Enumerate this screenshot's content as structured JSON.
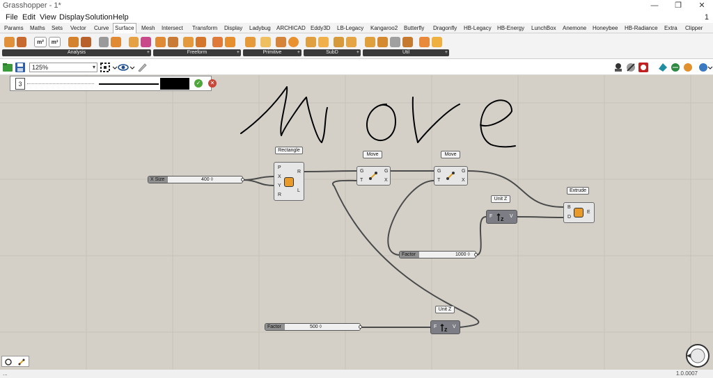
{
  "window": {
    "title": "Grasshopper - 1*",
    "minimize": "—",
    "restore": "❐",
    "close": "✕"
  },
  "menu": {
    "items": [
      "File",
      "Edit",
      "View",
      "Display",
      "Solution",
      "Help"
    ],
    "counter": "1"
  },
  "tabs": [
    "Params",
    "Maths",
    "Sets",
    "Vector",
    "Curve",
    "Surface",
    "Mesh",
    "Intersect",
    "Transform",
    "Display",
    "Ladybug",
    "ARCHICAD",
    "Eddy3D",
    "LB-Legacy",
    "Kangaroo2",
    "Butterfly",
    "Dragonfly",
    "HB-Legacy",
    "HB-Energy",
    "LunchBox",
    "Anemone",
    "Honeybee",
    "HB-Radiance",
    "Extra",
    "Clipper"
  ],
  "active_tab": "Surface",
  "ribbon_groups": [
    "Analysis",
    "Freeform",
    "Primitive",
    "SubD",
    "Util"
  ],
  "ribbon_plus": "+",
  "toolbar": {
    "zoom": "125%",
    "zoom_arrow": "▾"
  },
  "slider_panel": {
    "value": "3",
    "ok": "✓",
    "cancel": "✕"
  },
  "sketch_text": "Move",
  "components": {
    "rectangle": {
      "label": "Rectangle",
      "inputs": [
        "P",
        "X",
        "Y",
        "R"
      ],
      "outputs": [
        "R",
        "L"
      ]
    },
    "move1": {
      "label": "Move",
      "inputs": [
        "G",
        "T"
      ],
      "outputs": [
        "G",
        "X"
      ]
    },
    "move2": {
      "label": "Move",
      "inputs": [
        "G",
        "T"
      ],
      "outputs": [
        "G",
        "X"
      ]
    },
    "unitz1": {
      "label": "Unit Z",
      "inputs": [
        "F"
      ],
      "outputs": [
        "V"
      ]
    },
    "unitz2": {
      "label": "Unit Z",
      "inputs": [
        "F"
      ],
      "outputs": [
        "V"
      ]
    },
    "extrude": {
      "label": "Extrude",
      "inputs": [
        "B",
        "D"
      ],
      "outputs": [
        "E"
      ]
    }
  },
  "sliders": {
    "xsize": {
      "label": "X Size",
      "value": "400 ◊"
    },
    "factor1000": {
      "label": "Factor",
      "value": "1000 ◊"
    },
    "factor500": {
      "label": "Factor",
      "value": "500 ◊"
    }
  },
  "status": {
    "left": "...",
    "version": "1.0.0007"
  },
  "colors": {
    "canvas": "#d4d0c8",
    "wire": "#4a4a4a",
    "dark_component": "#7d7d85",
    "ribbon_label": "#3a3a3a"
  }
}
